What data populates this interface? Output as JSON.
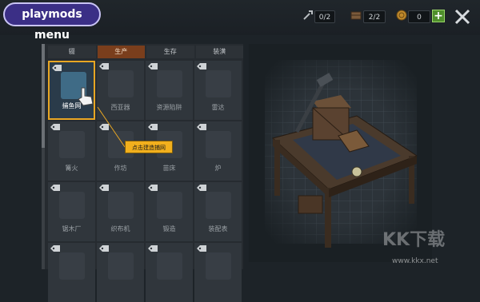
{
  "menu": {
    "label": "playmods menu"
  },
  "resources": {
    "wrench": {
      "value": "0/2",
      "icon": "wrench-icon"
    },
    "crate": {
      "value": "2/2",
      "icon": "crate-icon"
    },
    "coins": {
      "value": "0",
      "icon": "coin-icon"
    }
  },
  "tabs": [
    {
      "label": "辍"
    },
    {
      "label": "生产",
      "active": true
    },
    {
      "label": "生存"
    },
    {
      "label": "装潢"
    }
  ],
  "grid": [
    {
      "label": "捕鱼网",
      "selected": true
    },
    {
      "label": "西亚器"
    },
    {
      "label": "资源陷阱"
    },
    {
      "label": "雷达"
    },
    {
      "label": "篝火"
    },
    {
      "label": "作坊"
    },
    {
      "label": "苗床"
    },
    {
      "label": "炉"
    },
    {
      "label": "锯木厂"
    },
    {
      "label": "织布机"
    },
    {
      "label": "锻造"
    },
    {
      "label": "装配表"
    },
    {
      "label": ""
    },
    {
      "label": ""
    },
    {
      "label": ""
    },
    {
      "label": ""
    }
  ],
  "tooltip": {
    "text": "点击建造捕网"
  },
  "colors": {
    "accent": "#e8a623",
    "active_tab": "#7a3e1c",
    "menu_bg": "#3b2f86"
  },
  "watermark": {
    "brand": "KK下载",
    "url": "www.kkx.net"
  }
}
